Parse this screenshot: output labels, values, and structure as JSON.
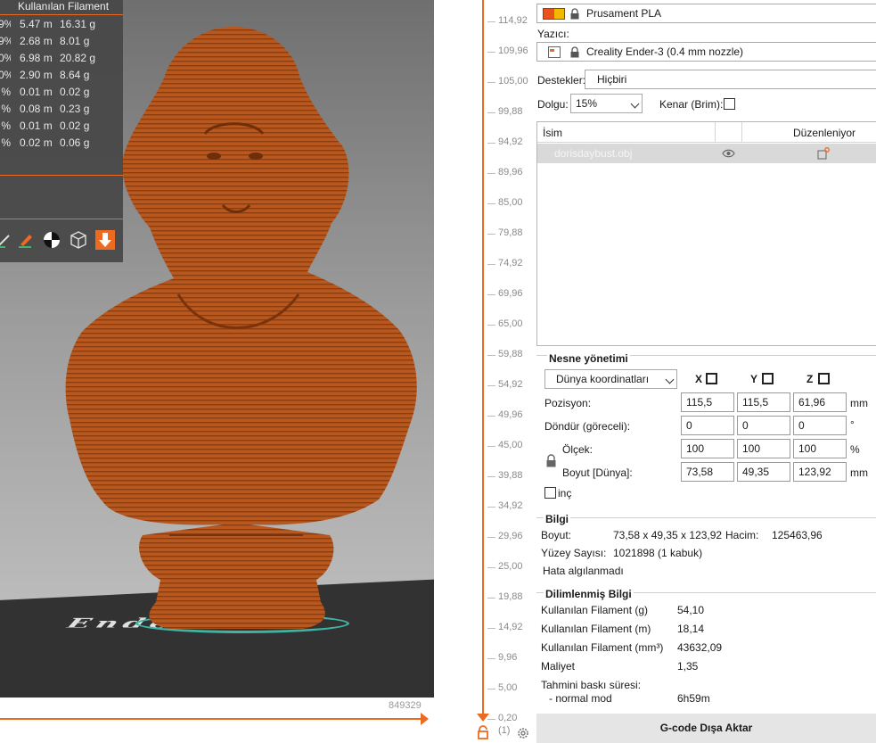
{
  "stats_panel": {
    "header": "Kullanılan Filament",
    "rows": [
      {
        "pct": "9%",
        "m": "5.47 m",
        "g": "16.31 g"
      },
      {
        "pct": "9%",
        "m": "2.68 m",
        "g": "8.01 g"
      },
      {
        "pct": "0%",
        "m": "6.98 m",
        "g": "20.82 g"
      },
      {
        "pct": "0%",
        "m": "2.90 m",
        "g": "8.64 g"
      },
      {
        "pct": "%",
        "m": "0.01 m",
        "g": "0.02 g"
      },
      {
        "pct": "%",
        "m": "0.08 m",
        "g": "0.23 g"
      },
      {
        "pct": "%",
        "m": "0.01 m",
        "g": "0.02 g"
      },
      {
        "pct": "%",
        "m": "0.02 m",
        "g": "0.06 g"
      }
    ],
    "toolbar_icons": [
      "brush-icon",
      "paint-icon",
      "contrast-icon",
      "wireframe-cube-icon",
      "download-arrow-icon"
    ]
  },
  "viewport": {
    "bed_text": "Ender",
    "h_slider_value": "849329"
  },
  "v_slider": {
    "labels": [
      "114,92",
      "109,96",
      "105,00",
      "99,88",
      "94,92",
      "89,96",
      "85,00",
      "79,88",
      "74,92",
      "69,96",
      "65,00",
      "59,88",
      "54,92",
      "49,96",
      "45,00",
      "39,88",
      "34,92",
      "29,96",
      "25,00",
      "19,88",
      "14,92",
      "9,96",
      "5,00",
      "0,20"
    ],
    "bottom_extra": "(1)"
  },
  "sidebar": {
    "filament": {
      "value": "Prusament PLA",
      "color_left": "#e8531c",
      "color_right": "#f5b800"
    },
    "printer_label": "Yazıcı:",
    "printer": {
      "value": "Creality Ender-3 (0.4 mm nozzle)"
    },
    "supports_label": "Destekler:",
    "supports_value": "Hiçbiri",
    "infill_label": "Dolgu:",
    "infill_value": "15%",
    "brim_label": "Kenar (Brim):",
    "object_list": {
      "col_name": "İsim",
      "col_editing": "Düzenleniyor",
      "rows": [
        {
          "name": "dorisdaybust.obj"
        }
      ]
    },
    "object_manipulation": {
      "title": "Nesne yönetimi",
      "coord_select": "Dünya koordinatları",
      "axes": [
        "X",
        "Y",
        "Z"
      ],
      "position_label": "Pozisyon:",
      "position": [
        "115,5",
        "115,5",
        "61,96"
      ],
      "position_unit": "mm",
      "rotate_label": "Döndür (göreceli):",
      "rotate": [
        "0",
        "0",
        "0"
      ],
      "rotate_unit": "°",
      "scale_label": "Ölçek:",
      "scale": [
        "100",
        "100",
        "100"
      ],
      "scale_unit": "%",
      "size_label": "Boyut [Dünya]:",
      "size": [
        "73,58",
        "49,35",
        "123,92"
      ],
      "size_unit": "mm",
      "inch_label": "inç"
    },
    "info": {
      "title": "Bilgi",
      "size_label": "Boyut:",
      "size_value": "73,58 x 49,35 x 123,92",
      "volume_label": "Hacim:",
      "volume_value": "125463,96",
      "facets_label": "Yüzey Sayısı:",
      "facets_value": "1021898 (1 kabuk)",
      "errors": "Hata algılanmadı"
    },
    "sliced_info": {
      "title": "Dilimlenmiş Bilgi",
      "rows": [
        {
          "label": "Kullanılan Filament (g)",
          "value": "54,10"
        },
        {
          "label": "Kullanılan Filament (m)",
          "value": "18,14"
        },
        {
          "label": "Kullanılan Filament (mm³)",
          "value": "43632,09"
        },
        {
          "label": "Maliyet",
          "value": "1,35"
        }
      ],
      "time_label": "Tahmini baskı süresi:",
      "mode_label": "- normal mod",
      "mode_value": "6h59m"
    },
    "export_button": "G-code Dışa Aktar"
  },
  "colors": {
    "accent": "#ed6b21",
    "model": "#b8571c"
  }
}
